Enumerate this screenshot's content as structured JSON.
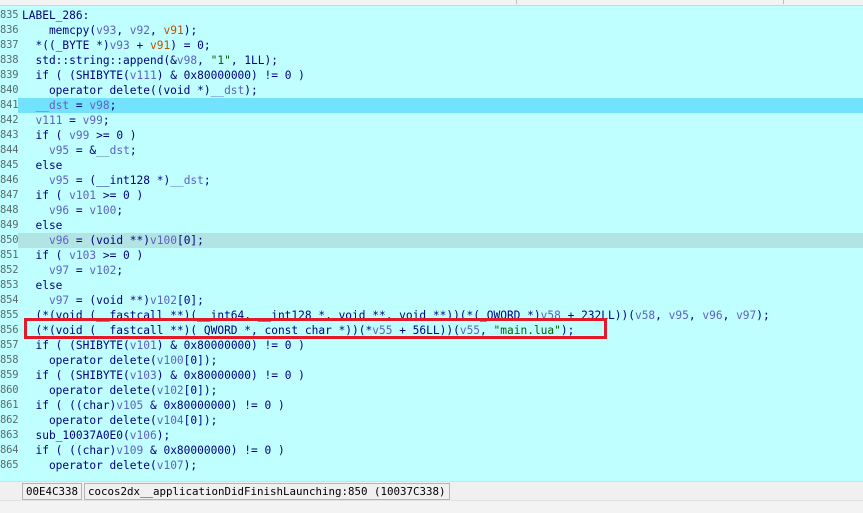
{
  "code_lines": [
    {
      "no": "835",
      "tokens": [
        {
          "t": "LABEL_286:",
          "c": "kw"
        }
      ]
    },
    {
      "no": "836",
      "tokens": [
        {
          "t": "    memcpy(",
          "c": "id"
        },
        {
          "t": "v93",
          "c": "var"
        },
        {
          "t": ", ",
          "c": "id"
        },
        {
          "t": "v92",
          "c": "var"
        },
        {
          "t": ", ",
          "c": "id"
        },
        {
          "t": "v91",
          "c": "arg"
        },
        {
          "t": ");",
          "c": "id"
        }
      ]
    },
    {
      "no": "837",
      "tokens": [
        {
          "t": "  *((_BYTE *)",
          "c": "id"
        },
        {
          "t": "v93",
          "c": "var"
        },
        {
          "t": " + ",
          "c": "id"
        },
        {
          "t": "v91",
          "c": "arg"
        },
        {
          "t": ") = 0;",
          "c": "id"
        }
      ]
    },
    {
      "no": "838",
      "tokens": [
        {
          "t": "  std::string::append(&",
          "c": "id"
        },
        {
          "t": "v98",
          "c": "var"
        },
        {
          "t": ", ",
          "c": "id"
        },
        {
          "t": "\"1\"",
          "c": "str"
        },
        {
          "t": ", 1LL);",
          "c": "id"
        }
      ]
    },
    {
      "no": "839",
      "tokens": [
        {
          "t": "  if ( (SHIBYTE(",
          "c": "id"
        },
        {
          "t": "v111",
          "c": "var"
        },
        {
          "t": ") & 0x80000000) != 0 )",
          "c": "id"
        }
      ]
    },
    {
      "no": "840",
      "tokens": [
        {
          "t": "    operator delete((void *)",
          "c": "id"
        },
        {
          "t": "__dst",
          "c": "var"
        },
        {
          "t": ");",
          "c": "id"
        }
      ]
    },
    {
      "no": "841",
      "tokens": [
        {
          "t": "  ",
          "c": "id"
        },
        {
          "t": "__dst",
          "c": "var"
        },
        {
          "t": " = ",
          "c": "id"
        },
        {
          "t": "v98",
          "c": "var"
        },
        {
          "t": ";",
          "c": "id"
        }
      ]
    },
    {
      "no": "842",
      "tokens": [
        {
          "t": "  ",
          "c": "id"
        },
        {
          "t": "v111",
          "c": "var"
        },
        {
          "t": " = ",
          "c": "id"
        },
        {
          "t": "v99",
          "c": "var"
        },
        {
          "t": ";",
          "c": "id"
        }
      ]
    },
    {
      "no": "843",
      "tokens": [
        {
          "t": "  if ( ",
          "c": "id"
        },
        {
          "t": "v99",
          "c": "var"
        },
        {
          "t": " >= 0 )",
          "c": "id"
        }
      ]
    },
    {
      "no": "844",
      "tokens": [
        {
          "t": "    ",
          "c": "id"
        },
        {
          "t": "v95",
          "c": "var"
        },
        {
          "t": " = &",
          "c": "id"
        },
        {
          "t": "__dst",
          "c": "var"
        },
        {
          "t": ";",
          "c": "id"
        }
      ]
    },
    {
      "no": "845",
      "tokens": [
        {
          "t": "  else",
          "c": "kw"
        }
      ]
    },
    {
      "no": "846",
      "tokens": [
        {
          "t": "    ",
          "c": "id"
        },
        {
          "t": "v95",
          "c": "var"
        },
        {
          "t": " = (__int128 *)",
          "c": "id"
        },
        {
          "t": "__dst",
          "c": "var"
        },
        {
          "t": ";",
          "c": "id"
        }
      ]
    },
    {
      "no": "847",
      "tokens": [
        {
          "t": "  if ( ",
          "c": "id"
        },
        {
          "t": "v101",
          "c": "var"
        },
        {
          "t": " >= 0 )",
          "c": "id"
        }
      ]
    },
    {
      "no": "848",
      "tokens": [
        {
          "t": "    ",
          "c": "id"
        },
        {
          "t": "v96",
          "c": "var"
        },
        {
          "t": " = ",
          "c": "id"
        },
        {
          "t": "v100",
          "c": "var"
        },
        {
          "t": ";",
          "c": "id"
        }
      ]
    },
    {
      "no": "849",
      "tokens": [
        {
          "t": "  else",
          "c": "kw"
        }
      ]
    },
    {
      "no": "850",
      "tokens": [
        {
          "t": "    ",
          "c": "id"
        },
        {
          "t": "v96",
          "c": "var"
        },
        {
          "t": " = (void **)",
          "c": "id"
        },
        {
          "t": "v100",
          "c": "var"
        },
        {
          "t": "[0];",
          "c": "id"
        }
      ]
    },
    {
      "no": "851",
      "tokens": [
        {
          "t": "  if ( ",
          "c": "id"
        },
        {
          "t": "v103",
          "c": "var"
        },
        {
          "t": " >= 0 )",
          "c": "id"
        }
      ]
    },
    {
      "no": "852",
      "tokens": [
        {
          "t": "    ",
          "c": "id"
        },
        {
          "t": "v97",
          "c": "var"
        },
        {
          "t": " = ",
          "c": "id"
        },
        {
          "t": "v102",
          "c": "var"
        },
        {
          "t": ";",
          "c": "id"
        }
      ]
    },
    {
      "no": "853",
      "tokens": [
        {
          "t": "  else",
          "c": "kw"
        }
      ]
    },
    {
      "no": "854",
      "tokens": [
        {
          "t": "    ",
          "c": "id"
        },
        {
          "t": "v97",
          "c": "var"
        },
        {
          "t": " = (void **)",
          "c": "id"
        },
        {
          "t": "v102",
          "c": "var"
        },
        {
          "t": "[0];",
          "c": "id"
        }
      ]
    },
    {
      "no": "855",
      "tokens": [
        {
          "t": "  (*(void (__fastcall **)(__int64, __int128 *, void **, void **))(*(_QWORD *)",
          "c": "id"
        },
        {
          "t": "v58",
          "c": "var"
        },
        {
          "t": " + 232LL))(",
          "c": "id"
        },
        {
          "t": "v58",
          "c": "var"
        },
        {
          "t": ", ",
          "c": "id"
        },
        {
          "t": "v95",
          "c": "var"
        },
        {
          "t": ", ",
          "c": "id"
        },
        {
          "t": "v96",
          "c": "var"
        },
        {
          "t": ", ",
          "c": "id"
        },
        {
          "t": "v97",
          "c": "var"
        },
        {
          "t": ");",
          "c": "id"
        }
      ]
    },
    {
      "no": "856",
      "tokens": [
        {
          "t": "  (*(void (__fastcall **)(_QWORD *, const char *))(*",
          "c": "id"
        },
        {
          "t": "v55",
          "c": "var"
        },
        {
          "t": " + 56LL))(",
          "c": "id"
        },
        {
          "t": "v55",
          "c": "var"
        },
        {
          "t": ", ",
          "c": "id"
        },
        {
          "t": "\"main.lua\"",
          "c": "str"
        },
        {
          "t": ");",
          "c": "id"
        }
      ]
    },
    {
      "no": "857",
      "tokens": [
        {
          "t": "  if ( (SHIBYTE(",
          "c": "id"
        },
        {
          "t": "v101",
          "c": "var"
        },
        {
          "t": ") & 0x80000000) != 0 )",
          "c": "id"
        }
      ]
    },
    {
      "no": "858",
      "tokens": [
        {
          "t": "    operator delete(",
          "c": "id"
        },
        {
          "t": "v100",
          "c": "var"
        },
        {
          "t": "[0]);",
          "c": "id"
        }
      ]
    },
    {
      "no": "859",
      "tokens": [
        {
          "t": "  if ( (SHIBYTE(",
          "c": "id"
        },
        {
          "t": "v103",
          "c": "var"
        },
        {
          "t": ") & 0x80000000) != 0 )",
          "c": "id"
        }
      ]
    },
    {
      "no": "860",
      "tokens": [
        {
          "t": "    operator delete(",
          "c": "id"
        },
        {
          "t": "v102",
          "c": "var"
        },
        {
          "t": "[0]);",
          "c": "id"
        }
      ]
    },
    {
      "no": "861",
      "tokens": [
        {
          "t": "  if ( ((char)",
          "c": "id"
        },
        {
          "t": "v105",
          "c": "var"
        },
        {
          "t": " & 0x80000000) != 0 )",
          "c": "id"
        }
      ]
    },
    {
      "no": "862",
      "tokens": [
        {
          "t": "    operator delete(",
          "c": "id"
        },
        {
          "t": "v104",
          "c": "var"
        },
        {
          "t": "[0]);",
          "c": "id"
        }
      ]
    },
    {
      "no": "863",
      "tokens": [
        {
          "t": "  sub_10037A0E0(",
          "c": "id"
        },
        {
          "t": "v106",
          "c": "var"
        },
        {
          "t": ");",
          "c": "id"
        }
      ]
    },
    {
      "no": "864",
      "tokens": [
        {
          "t": "  if ( ((char)",
          "c": "id"
        },
        {
          "t": "v109",
          "c": "var"
        },
        {
          "t": " & 0x80000000) != 0 )",
          "c": "id"
        }
      ]
    },
    {
      "no": "865",
      "tokens": [
        {
          "t": "    operator delete(",
          "c": "id"
        },
        {
          "t": "v107",
          "c": "var"
        },
        {
          "t": ");",
          "c": "id"
        }
      ]
    }
  ],
  "cursor_line_index": 6,
  "shaded_line_index": 15,
  "highlight_line_index": 21,
  "colors": {
    "background": "#c0ffff",
    "cursor_line": "#73e2fd",
    "highlight_box": "#e21a2a",
    "string_literal": "#006400",
    "argument": "#c05000"
  },
  "status_bar": {
    "address": "00E4C338",
    "location": "cocos2dx__applicationDidFinishLaunching:850 (10037C338)"
  }
}
